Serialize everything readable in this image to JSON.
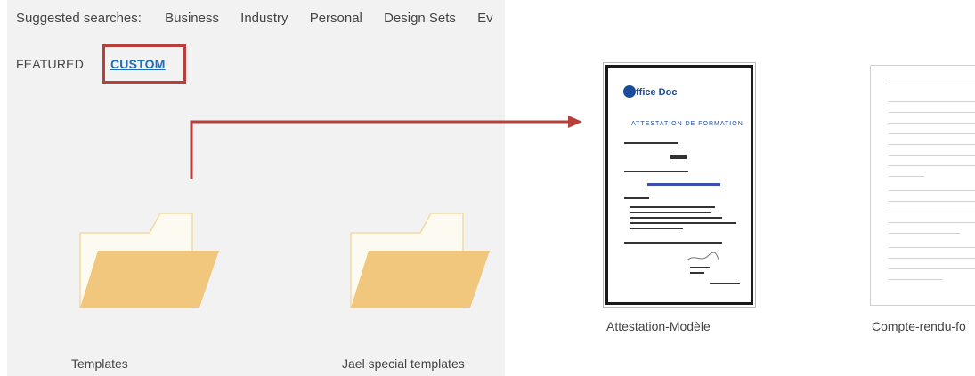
{
  "suggested": {
    "label": "Suggested searches:",
    "links": [
      "Business",
      "Industry",
      "Personal",
      "Design Sets",
      "Ev"
    ]
  },
  "tabs": {
    "featured": "FEATURED",
    "custom": "CUSTOM"
  },
  "folders": [
    {
      "label": "Templates"
    },
    {
      "label": "Jael special templates"
    }
  ],
  "templates": [
    {
      "label": "Attestation-Modèle",
      "preview": {
        "logo_text": "ffice Doc",
        "heading": "ATTESTATION DE FORMATION"
      }
    },
    {
      "label": "Compte-rendu-fo"
    }
  ],
  "colors": {
    "accent_link": "#1e6fb8",
    "highlight": "#b7403a",
    "folder_front": "#f0c77d",
    "folder_back": "#fdfaf2",
    "folder_tab_border": "#f3d9a6"
  },
  "icons": [
    "folder-icon",
    "folder-icon",
    "arrow-connector-icon"
  ]
}
